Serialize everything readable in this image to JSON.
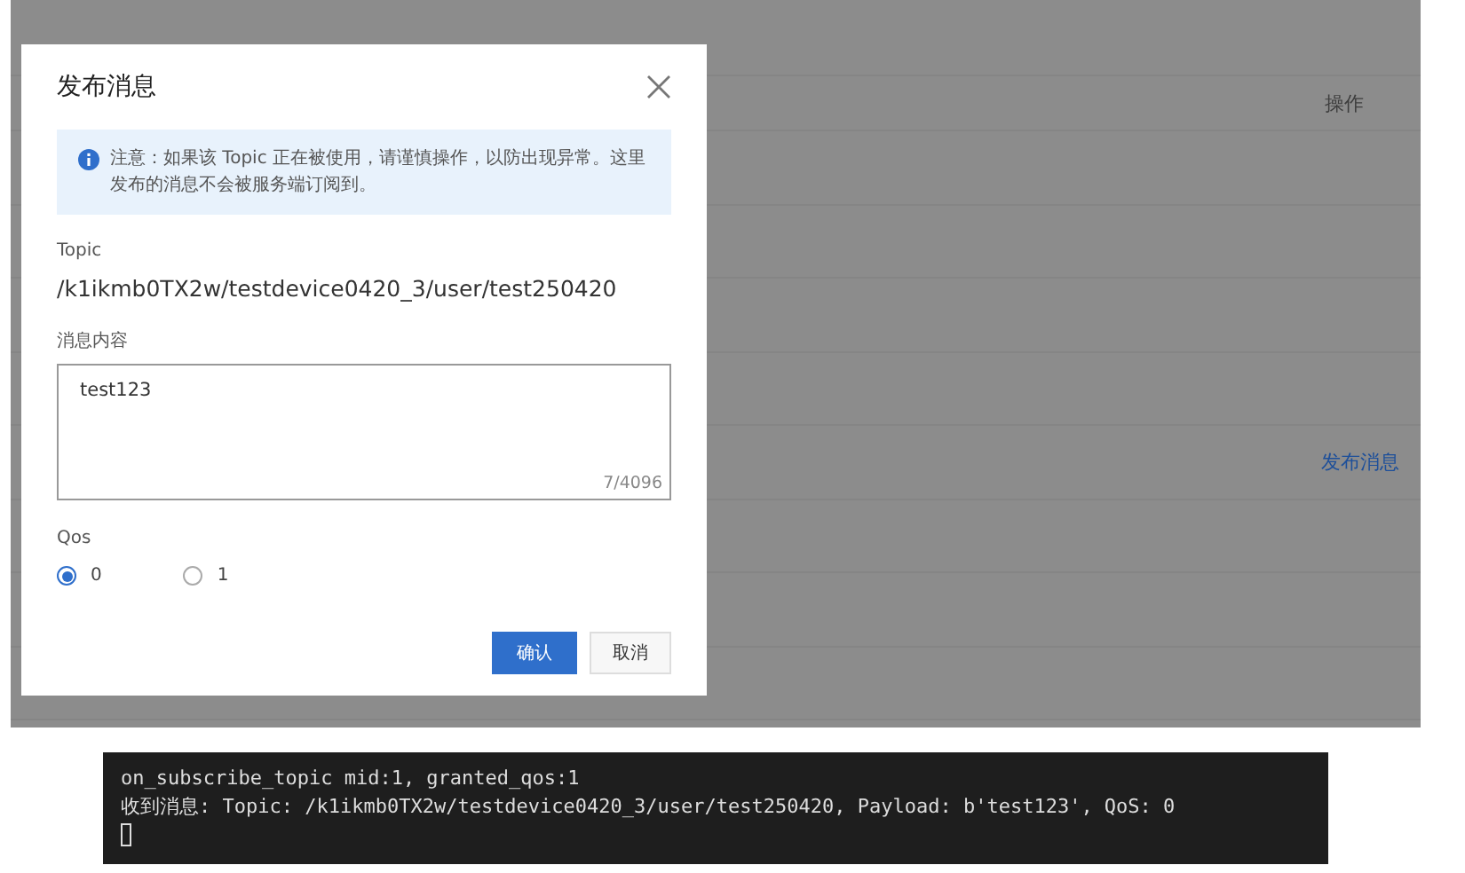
{
  "table": {
    "header_action": "操作",
    "rows": [
      {},
      {},
      {},
      {},
      {
        "action": "发布消息"
      },
      {},
      {},
      {}
    ]
  },
  "dialog": {
    "title": "发布消息",
    "notice": "注意：如果该 Topic 正在被使用，请谨慎操作，以防出现异常。这里发布的消息不会被服务端订阅到。",
    "topic_label": "Topic",
    "topic_value": "/k1ikmb0TX2w/testdevice0420_3/user/test250420",
    "content_label": "消息内容",
    "content_value": "test123",
    "counter": "7/4096",
    "qos_label": "Qos",
    "qos_options": [
      {
        "label": "0",
        "selected": true
      },
      {
        "label": "1",
        "selected": false
      }
    ],
    "buttons": [
      {
        "label": "确认",
        "kind": "primary"
      },
      {
        "label": "取消",
        "kind": "secondary"
      }
    ]
  },
  "terminal": {
    "lines": [
      "on_subscribe_topic mid:1, granted_qos:1",
      "收到消息: Topic: /k1ikmb0TX2w/testdevice0420_3/user/test250420, Payload: b'test123', QoS: 0"
    ]
  }
}
